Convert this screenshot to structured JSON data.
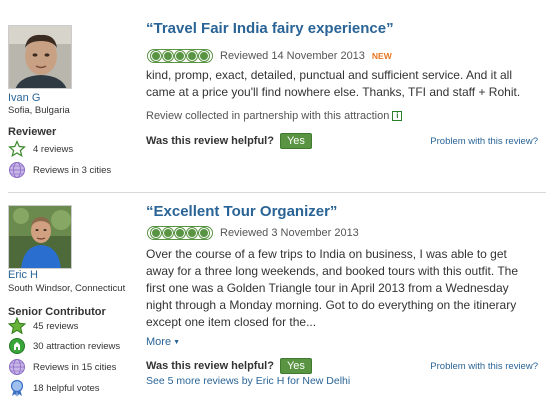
{
  "reviews": [
    {
      "reviewer": {
        "name": "Ivan G",
        "location": "Sofia, Bulgaria",
        "rank": "Reviewer",
        "badges": [
          {
            "icon": "star-outline-icon",
            "label": "4 reviews"
          },
          {
            "icon": "globe-icon",
            "label": "Reviews in 3 cities"
          }
        ]
      },
      "title": "“Travel Fair India fairy experience”",
      "rating": 5,
      "date": "Reviewed 14 November 2013",
      "new_label": "NEW",
      "text": "kind, promp, exact, detailed, punctual and sufficient service. And it all came at a price you'll find nowhere else. Thanks, TFI and staff + Rohit.",
      "partner_note": "Review collected in partnership with this attraction",
      "helpful_question": "Was this review helpful?",
      "yes_label": "Yes",
      "problem_link": "Problem with this review?"
    },
    {
      "reviewer": {
        "name": "Eric H",
        "location": "South Windsor, Connecticut",
        "rank": "Senior Contributor",
        "badges": [
          {
            "icon": "star-filled-icon",
            "label": "45 reviews"
          },
          {
            "icon": "attraction-icon",
            "label": "30 attraction reviews"
          },
          {
            "icon": "globe-icon",
            "label": "Reviews in 15 cities"
          },
          {
            "icon": "ribbon-icon",
            "label": "18 helpful votes"
          }
        ]
      },
      "title": "“Excellent Tour Organizer”",
      "rating": 5,
      "date": "Reviewed 3 November 2013",
      "text": "Over the course of a few trips to India on business, I was able to get away for a three long weekends, and booked tours with this outfit. The first one was a Golden Triangle tour in April 2013 from a Wednesday night through a Monday morning. Got to do everything on the itinerary except one item closed for the...",
      "more_label": "More",
      "helpful_question": "Was this review helpful?",
      "yes_label": "Yes",
      "problem_link": "Problem with this review?",
      "see_more": "See 5 more reviews by Eric H for New Delhi"
    }
  ],
  "colors": {
    "link": "#2a6496",
    "bubble_green": "#589442",
    "new_orange": "#e87722"
  }
}
